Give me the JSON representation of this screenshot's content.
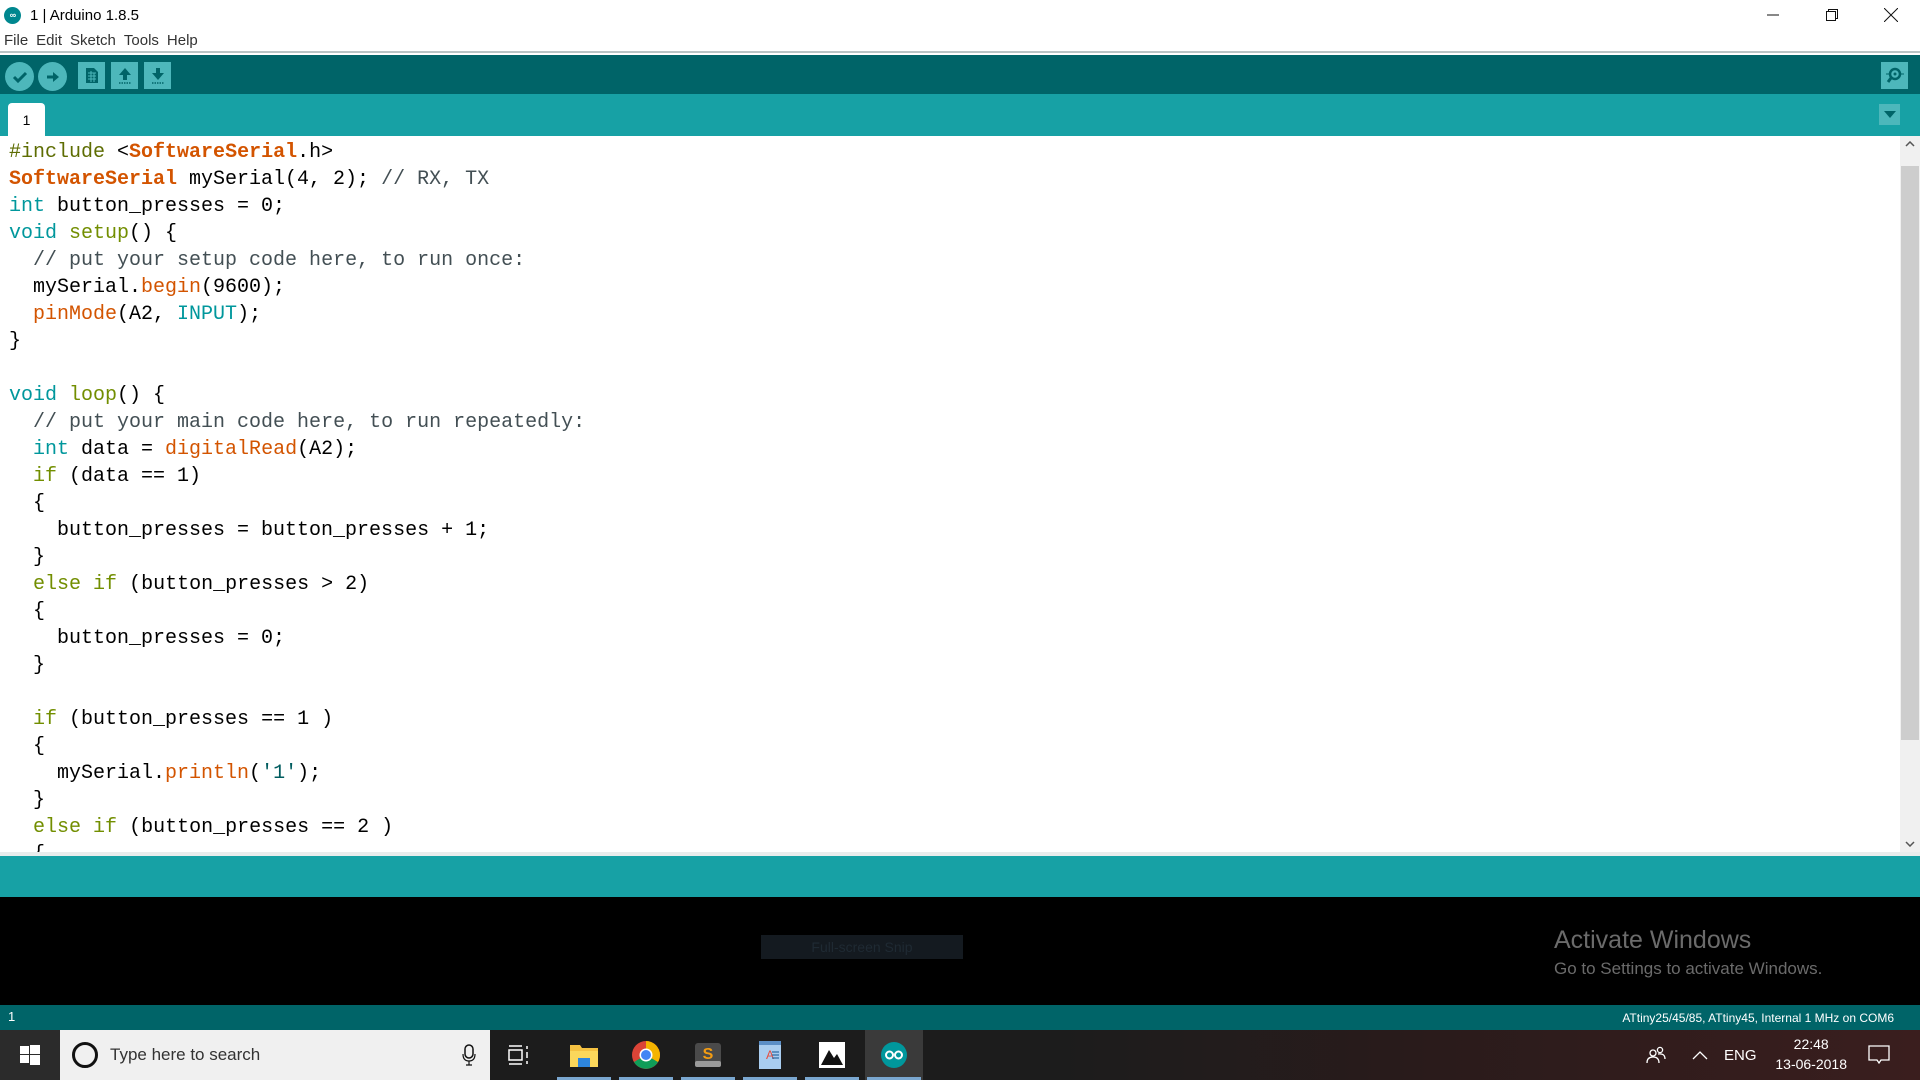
{
  "window": {
    "title": "1 | Arduino 1.8.5",
    "app_icon": "arduino-logo-icon",
    "controls": [
      "minimize-icon",
      "restore-icon",
      "close-icon"
    ]
  },
  "menu": {
    "items": [
      "File",
      "Edit",
      "Sketch",
      "Tools",
      "Help"
    ]
  },
  "toolbar": {
    "buttons": [
      {
        "name": "verify",
        "icon": "checkmark-icon"
      },
      {
        "name": "upload",
        "icon": "arrow-right-icon"
      },
      {
        "name": "new",
        "icon": "new-file-icon"
      },
      {
        "name": "open",
        "icon": "arrow-up-icon"
      },
      {
        "name": "save",
        "icon": "arrow-down-icon"
      }
    ],
    "serial_monitor_icon": "magnifier-icon"
  },
  "tabs": {
    "items": [
      {
        "label": "1",
        "active": true
      }
    ],
    "menu_icon": "triangle-down-icon"
  },
  "editor": {
    "lines": [
      [
        [
          "pre",
          "#include "
        ],
        [
          "plain",
          "<"
        ],
        [
          "lib",
          "SoftwareSerial"
        ],
        [
          "plain",
          ".h>"
        ]
      ],
      [
        [
          "lib",
          "SoftwareSerial"
        ],
        [
          "plain",
          " mySerial(4, 2); "
        ],
        [
          "com",
          "// RX, TX"
        ]
      ],
      [
        [
          "type",
          "int"
        ],
        [
          "plain",
          " button_presses = 0;"
        ]
      ],
      [
        [
          "type",
          "void"
        ],
        [
          "plain",
          " "
        ],
        [
          "kw",
          "setup"
        ],
        [
          "plain",
          "() {"
        ]
      ],
      [
        [
          "plain",
          "  "
        ],
        [
          "com",
          "// put your setup code here, to run once:"
        ]
      ],
      [
        [
          "plain",
          "  mySerial."
        ],
        [
          "fn",
          "begin"
        ],
        [
          "plain",
          "(9600);"
        ]
      ],
      [
        [
          "plain",
          "  "
        ],
        [
          "fn",
          "pinMode"
        ],
        [
          "plain",
          "(A2, "
        ],
        [
          "const",
          "INPUT"
        ],
        [
          "plain",
          ");"
        ]
      ],
      [
        [
          "plain",
          "}"
        ]
      ],
      [
        [
          "plain",
          ""
        ]
      ],
      [
        [
          "type",
          "void"
        ],
        [
          "plain",
          " "
        ],
        [
          "kw",
          "loop"
        ],
        [
          "plain",
          "() {"
        ]
      ],
      [
        [
          "plain",
          "  "
        ],
        [
          "com",
          "// put your main code here, to run repeatedly:"
        ]
      ],
      [
        [
          "plain",
          "  "
        ],
        [
          "type",
          "int"
        ],
        [
          "plain",
          " data = "
        ],
        [
          "fn",
          "digitalRead"
        ],
        [
          "plain",
          "(A2);"
        ]
      ],
      [
        [
          "plain",
          "  "
        ],
        [
          "kw",
          "if"
        ],
        [
          "plain",
          " (data == 1)"
        ]
      ],
      [
        [
          "plain",
          "  {"
        ]
      ],
      [
        [
          "plain",
          "    button_presses = button_presses + 1;"
        ]
      ],
      [
        [
          "plain",
          "  }"
        ]
      ],
      [
        [
          "plain",
          "  "
        ],
        [
          "kw",
          "else"
        ],
        [
          "plain",
          " "
        ],
        [
          "kw",
          "if"
        ],
        [
          "plain",
          " (button_presses > 2)"
        ]
      ],
      [
        [
          "plain",
          "  {"
        ]
      ],
      [
        [
          "plain",
          "    button_presses = 0;"
        ]
      ],
      [
        [
          "plain",
          "  }"
        ]
      ],
      [
        [
          "plain",
          ""
        ]
      ],
      [
        [
          "plain",
          "  "
        ],
        [
          "kw",
          "if"
        ],
        [
          "plain",
          " (button_presses == 1 )"
        ]
      ],
      [
        [
          "plain",
          "  {"
        ]
      ],
      [
        [
          "plain",
          "    mySerial."
        ],
        [
          "fn",
          "println"
        ],
        [
          "plain",
          "("
        ],
        [
          "str",
          "'1'"
        ],
        [
          "plain",
          ");"
        ]
      ],
      [
        [
          "plain",
          "  }"
        ]
      ],
      [
        [
          "plain",
          "  "
        ],
        [
          "kw",
          "else"
        ],
        [
          "plain",
          " "
        ],
        [
          "kw",
          "if"
        ],
        [
          "plain",
          " (button_presses == 2 )"
        ]
      ],
      [
        [
          "plain",
          "  {"
        ]
      ]
    ],
    "scroll": {
      "thumb_start_fraction": 0.02,
      "thumb_end_fraction": 0.86
    }
  },
  "console": {
    "snip_label": "Full-screen Snip",
    "watermark_title": "Activate Windows",
    "watermark_subtitle": "Go to Settings to activate Windows."
  },
  "status": {
    "line_number": "1",
    "board": "ATtiny25/45/85, ATtiny45, Internal 1 MHz on COM6"
  },
  "taskbar": {
    "search_placeholder": "Type here to search",
    "apps": [
      {
        "name": "task-view",
        "icon": "task-view-icon"
      },
      {
        "name": "file-explorer",
        "icon": "folder-icon"
      },
      {
        "name": "chrome",
        "icon": "chrome-icon"
      },
      {
        "name": "sublime-text",
        "icon": "sublime-icon"
      },
      {
        "name": "wordpad",
        "icon": "wordpad-icon"
      },
      {
        "name": "photos",
        "icon": "photos-icon"
      },
      {
        "name": "arduino",
        "icon": "arduino-icon"
      }
    ],
    "tray": {
      "language": "ENG",
      "time": "22:48",
      "date": "13-06-2018"
    }
  },
  "colors": {
    "toolbar": "#006468",
    "tabbar": "#17a1a5",
    "button": "#4db7bb",
    "keyword_type": "#00979c",
    "library": "#d35400",
    "keyword": "#728e00"
  }
}
